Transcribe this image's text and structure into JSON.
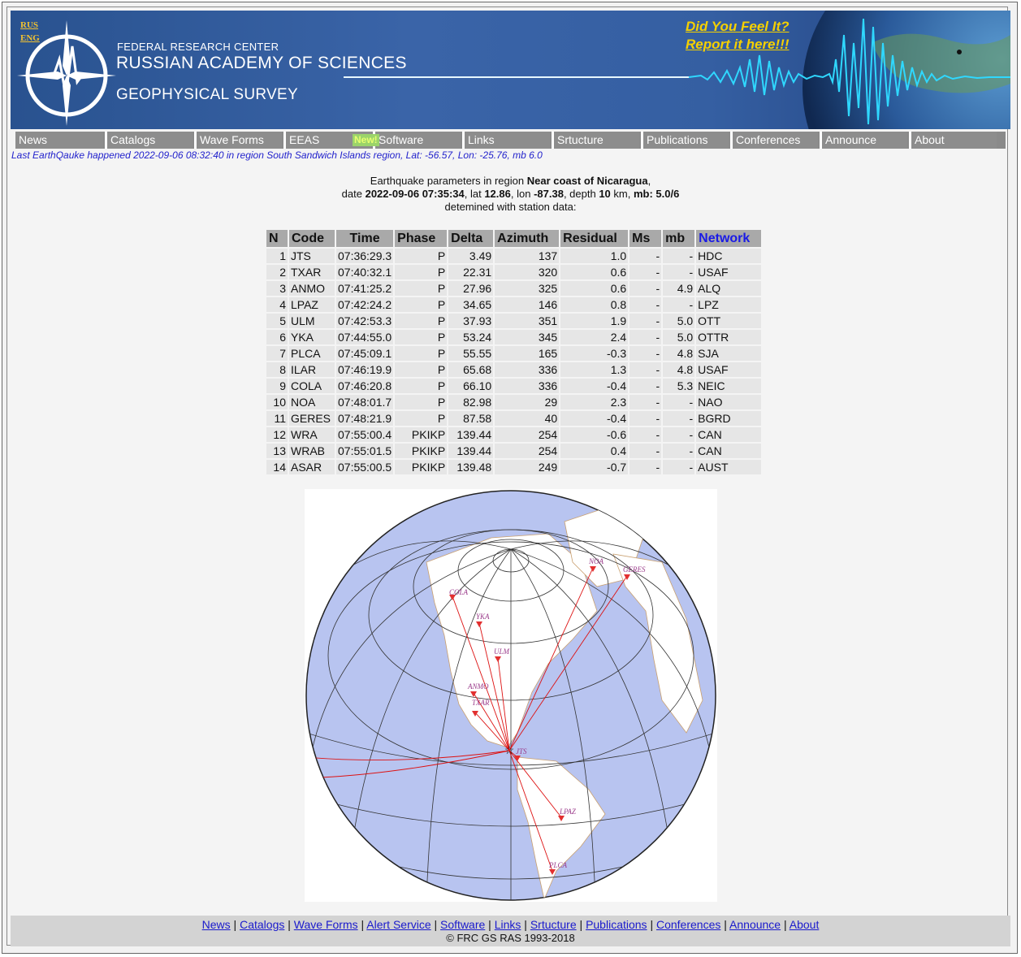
{
  "header": {
    "lang_rus": "RUS",
    "lang_eng": "ENG",
    "org_line1": "FEDERAL RESEARCH CENTER",
    "org_line2": "RUSSIAN ACADEMY OF SCIENCES",
    "org_line3": "GEOPHYSICAL SURVEY",
    "feel_line1": "Did You Feel It?",
    "feel_line2": "Report it here!!!"
  },
  "nav": {
    "items": [
      "News",
      "Catalogs",
      "Wave Forms",
      "EEAS",
      "Software",
      "Links",
      "Srtucture",
      "Publications",
      "Conferences",
      "Announce",
      "About"
    ],
    "new_badge": "New!"
  },
  "last_quake": "Last EarthQauke happened 2022-09-06 08:32:40 in region South Sandwich Islands region, Lat: -56.57, Lon: -25.76, mb 6.0",
  "params": {
    "l1_pre": "Earthquake parameters in region ",
    "region": "Near coast of Nicaragua",
    "l1_post": ",",
    "l2_date_label": "date ",
    "date": "2022-09-06 07:35:34",
    "lat_label": ", lat ",
    "lat": "12.86",
    "lon_label": ", lon ",
    "lon": "-87.38",
    "depth_label": ", depth ",
    "depth": "10",
    "km_label": " km, ",
    "mb_label": "mb: 5.0/6",
    "l3": "detemined with station data:"
  },
  "table": {
    "headers": [
      "N",
      "Code",
      "Time",
      "Phase",
      "Delta",
      "Azimuth",
      "Residual",
      "Ms",
      "mb",
      "Network"
    ],
    "rows": [
      [
        "1",
        "JTS",
        "07:36:29.3",
        "P",
        "3.49",
        "137",
        "1.0",
        "-",
        "-",
        "HDC"
      ],
      [
        "2",
        "TXAR",
        "07:40:32.1",
        "P",
        "22.31",
        "320",
        "0.6",
        "-",
        "-",
        "USAF"
      ],
      [
        "3",
        "ANMO",
        "07:41:25.2",
        "P",
        "27.96",
        "325",
        "0.6",
        "-",
        "4.9",
        "ALQ"
      ],
      [
        "4",
        "LPAZ",
        "07:42:24.2",
        "P",
        "34.65",
        "146",
        "0.8",
        "-",
        "-",
        "LPZ"
      ],
      [
        "5",
        "ULM",
        "07:42:53.3",
        "P",
        "37.93",
        "351",
        "1.9",
        "-",
        "5.0",
        "OTT"
      ],
      [
        "6",
        "YKA",
        "07:44:55.0",
        "P",
        "53.24",
        "345",
        "2.4",
        "-",
        "5.0",
        "OTTR"
      ],
      [
        "7",
        "PLCA",
        "07:45:09.1",
        "P",
        "55.55",
        "165",
        "-0.3",
        "-",
        "4.8",
        "SJA"
      ],
      [
        "8",
        "ILAR",
        "07:46:19.9",
        "P",
        "65.68",
        "336",
        "1.3",
        "-",
        "4.8",
        "USAF"
      ],
      [
        "9",
        "COLA",
        "07:46:20.8",
        "P",
        "66.10",
        "336",
        "-0.4",
        "-",
        "5.3",
        "NEIC"
      ],
      [
        "10",
        "NOA",
        "07:48:01.7",
        "P",
        "82.98",
        "29",
        "2.3",
        "-",
        "-",
        "NAO"
      ],
      [
        "11",
        "GERES",
        "07:48:21.9",
        "P",
        "87.58",
        "40",
        "-0.4",
        "-",
        "-",
        "BGRD"
      ],
      [
        "12",
        "WRA",
        "07:55:00.4",
        "PKIKP",
        "139.44",
        "254",
        "-0.6",
        "-",
        "-",
        "CAN"
      ],
      [
        "13",
        "WRAB",
        "07:55:01.5",
        "PKIKP",
        "139.44",
        "254",
        "0.4",
        "-",
        "-",
        "CAN"
      ],
      [
        "14",
        "ASAR",
        "07:55:00.5",
        "PKIKP",
        "139.48",
        "249",
        "-0.7",
        "-",
        "-",
        "AUST"
      ]
    ]
  },
  "map": {
    "station_labels": [
      "COLA",
      "YKA",
      "ULM",
      "ANMO",
      "TXAR",
      "JTS",
      "LPAZ",
      "PLCA",
      "NOA",
      "GERES"
    ],
    "colors": {
      "ocean": "#b8c4f0",
      "land": "#ffffff",
      "ray": "#dd1111",
      "station": "#e23030",
      "label": "#9a3a8a"
    }
  },
  "footer": {
    "links": [
      "News",
      "Catalogs",
      "Wave Forms",
      "Alert Service",
      "Software",
      "Links",
      "Srtucture",
      "Publications",
      "Conferences",
      "Announce",
      "About"
    ],
    "separator": " | ",
    "copyright": "© FRC GS RAS 1993-2018"
  },
  "colors": {
    "banner": "#3a64a8",
    "nav": "#8d8d8d",
    "link": "#1a1acc",
    "accent": "#f5d000"
  }
}
